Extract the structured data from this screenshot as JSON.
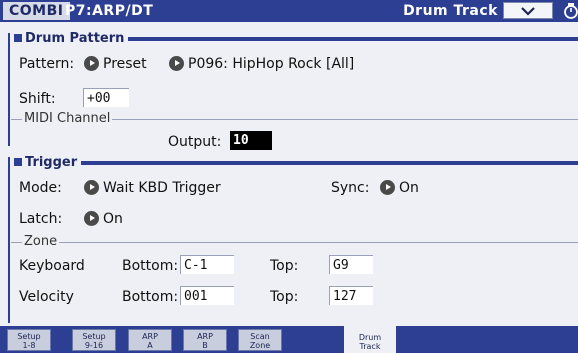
{
  "title": {
    "mode": "COMBI",
    "page": "P7:ARP/DT",
    "page_title": "Drum Track"
  },
  "drum_pattern": {
    "section_label": "Drum Pattern",
    "pattern_label": "Pattern:",
    "pattern_bank": "Preset",
    "pattern_value": "P096: HipHop Rock [All]",
    "shift_label": "Shift:",
    "shift_value": "+00",
    "midi_group_label": "MIDI Channel",
    "output_label": "Output:",
    "output_value": "10"
  },
  "trigger": {
    "section_label": "Trigger",
    "mode_label": "Mode:",
    "mode_value": "Wait KBD Trigger",
    "sync_label": "Sync:",
    "sync_value": "On",
    "latch_label": "Latch:",
    "latch_value": "On",
    "zone_group_label": "Zone",
    "keyboard_label": "Keyboard",
    "velocity_label": "Velocity",
    "bottom_label": "Bottom:",
    "top_label": "Top:",
    "keyboard_bottom": "C-1",
    "keyboard_top": "G9",
    "velocity_bottom": "001",
    "velocity_top": "127"
  },
  "tabs": [
    {
      "line1": "Setup",
      "line2": "1-8"
    },
    {
      "line1": "Setup",
      "line2": "9-16"
    },
    {
      "line1": "ARP",
      "line2": "A"
    },
    {
      "line1": "ARP",
      "line2": "B"
    },
    {
      "line1": "Scan",
      "line2": "Zone"
    },
    {
      "line1": "Drum",
      "line2": "Track"
    }
  ],
  "icons": {
    "menu": "chevron-down-icon",
    "lock": "lock-icon",
    "popup": "popup-arrow-icon"
  },
  "colors": {
    "accent": "#2c3f92",
    "background": "#eef0f6",
    "selected_field": "#000000"
  }
}
